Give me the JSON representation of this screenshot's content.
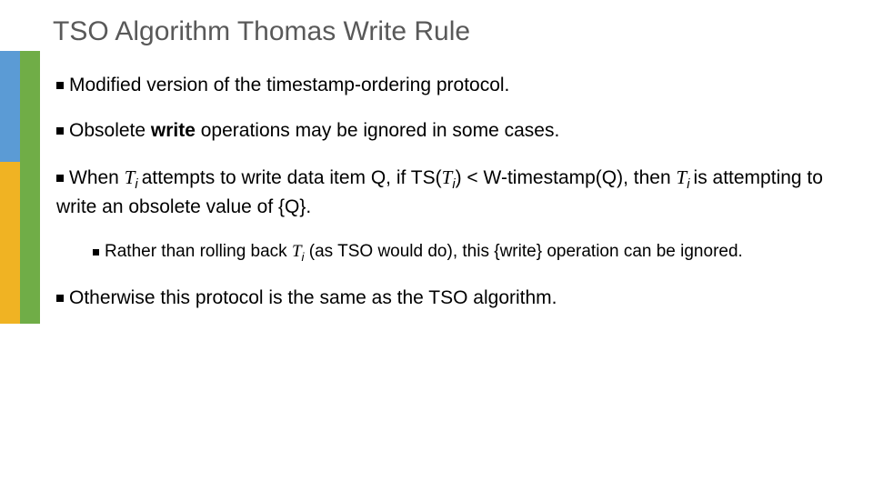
{
  "title": "TSO Algorithm Thomas Write Rule",
  "bullets": {
    "p1": "Modified version of the timestamp-ordering protocol.",
    "p2_pre": "Obsolete  ",
    "p2_bold": "write",
    "p2_post": " operations may be ignored in some cases.",
    "p3_a": "When ",
    "p3_T": "T",
    "p3_i": "i ",
    "p3_b": "attempts to write data item Q, if TS(",
    "p3_T2": "T",
    "p3_i2": "i",
    "p3_c": ") < W-timestamp(Q), then ",
    "p3_T3": "T",
    "p3_i3": "i ",
    "p3_d": "is attempting to write an obsolete value of {Q}.",
    "p4_a": "Rather than rolling back ",
    "p4_T": "T",
    "p4_i": "i",
    "p4_b": " (as TSO would do), this {write} operation can be ignored.",
    "p5": "Otherwise this protocol is the same as the TSO algorithm."
  }
}
